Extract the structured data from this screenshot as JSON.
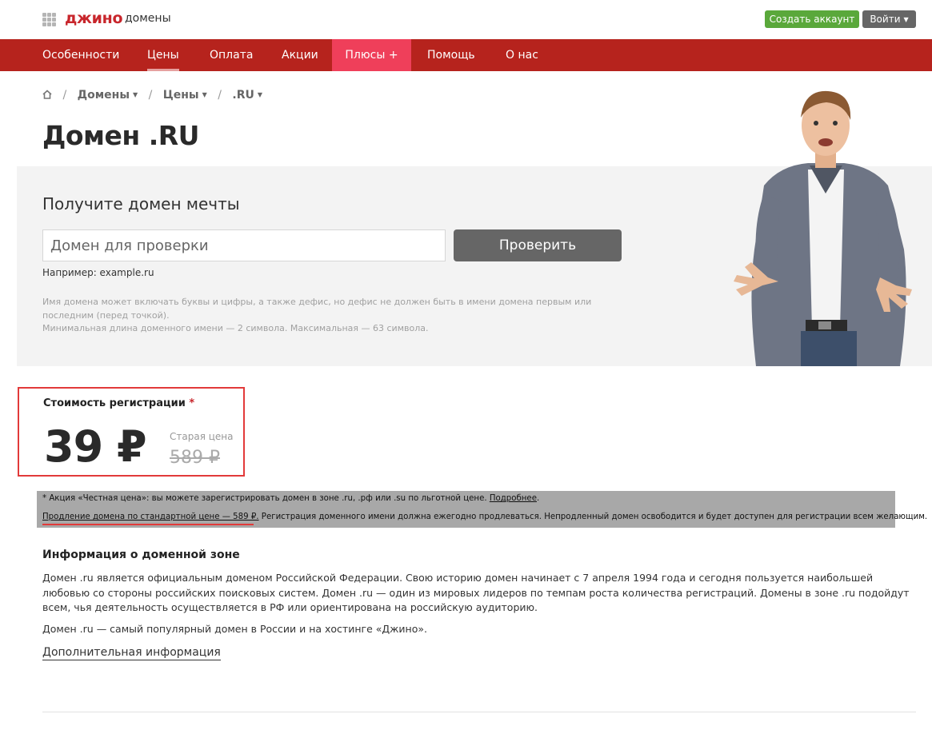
{
  "header": {
    "logo": "джино",
    "logo_sub": "домены",
    "signup_label": "Создать аккаунт",
    "login_label": "Войти"
  },
  "nav": {
    "items": [
      "Особенности",
      "Цены",
      "Оплата",
      "Акции",
      "Плюсы +",
      "Помощь",
      "О нас"
    ],
    "active": "Цены"
  },
  "breadcrumb": {
    "items": [
      "Домены",
      "Цены",
      ".RU"
    ]
  },
  "page": {
    "title": "Домен .RU"
  },
  "search": {
    "title": "Получите домен мечты",
    "placeholder": "Домен для проверки",
    "button": "Проверить",
    "example": "Например: example.ru",
    "hint_line1": "Имя домена может включать буквы и цифры, а также дефис, но дефис не должен быть в имени домена первым или",
    "hint_line2": "последним (перед точкой).",
    "hint_line3": "Минимальная длина доменного имени — 2 символа. Максимальная — 63 символа."
  },
  "price": {
    "label": "Стоимость регистрации",
    "star": "*",
    "value": "39 ₽",
    "old_label": "Старая цена",
    "old_value": "589 ₽"
  },
  "notice": {
    "line1_text": "* Акция «Честная цена»: вы можете зарегистрировать домен в зоне .ru, .рф или .su по льготной цене. ",
    "line1_link": "Подробнее",
    "line1_end": ".",
    "line2_underlined": "Продление домена по стандартной цене — 589 ₽.",
    "line2_text": " Регистрация доменного имени должна ежегодно продлеваться. Непродленный домен освободится и будет доступен для регистрации всем желающим."
  },
  "info": {
    "title": "Информация о доменной зоне",
    "paragraph1": "Домен .ru является официальным доменом Российской Федерации. Свою историю домен начинает с 7 апреля 1994 года и сегодня пользуется наибольшей любовью со стороны российских поисковых систем. Домен .ru — один из мировых лидеров по темпам роста количества регистраций. Домены в зоне .ru подойдут всем, чья деятельность осуществляется в РФ или ориентирована на российскую аудиторию.",
    "paragraph2": "Домен .ru — самый популярный домен в России и на хостинге «Джино».",
    "more_link": "Дополнительная информация"
  },
  "colors": {
    "brand_red": "#b6231d",
    "plus_pink": "#ef3f5a",
    "signup_green": "#5aa83b",
    "highlight_red": "#e23a3a"
  },
  "icons": [
    "apps-grid-icon",
    "home-icon",
    "caret-down-icon"
  ]
}
